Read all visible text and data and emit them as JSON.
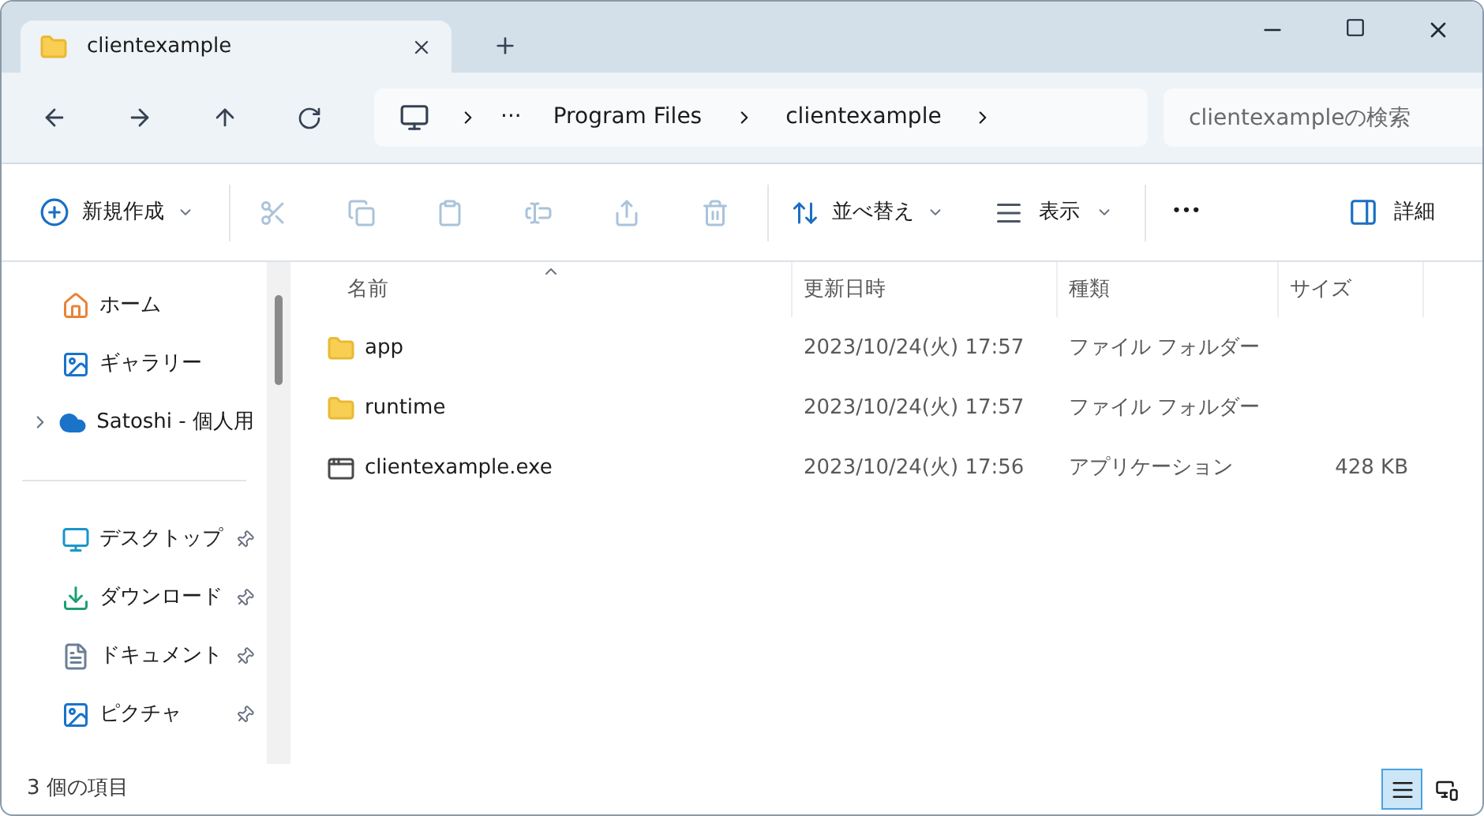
{
  "tab": {
    "title": "clientexample"
  },
  "address": {
    "crumbs": [
      "Program Files",
      "clientexample"
    ],
    "overflow": "···"
  },
  "search": {
    "placeholder": "clientexampleの検索"
  },
  "toolbar": {
    "new_label": "新規作成",
    "actions": [
      {
        "kind": "cut",
        "disabled": true
      },
      {
        "kind": "copy",
        "disabled": true
      },
      {
        "kind": "paste",
        "disabled": true
      },
      {
        "kind": "rename",
        "disabled": true
      },
      {
        "kind": "share",
        "disabled": true
      },
      {
        "kind": "delete",
        "disabled": true
      }
    ],
    "sort_label": "並べ替え",
    "view_label": "表示",
    "more": "•••",
    "details_label": "詳細"
  },
  "sidebar": {
    "items": [
      {
        "kind": "home",
        "label": "ホーム",
        "expandable": false
      },
      {
        "kind": "gallery",
        "label": "ギャラリー",
        "expandable": false
      },
      {
        "kind": "cloud",
        "label": "Satoshi - 個人用",
        "expandable": true
      }
    ],
    "pinned": [
      {
        "kind": "desktop",
        "label": "デスクトップ",
        "pinned": true
      },
      {
        "kind": "download",
        "label": "ダウンロード",
        "pinned": true
      },
      {
        "kind": "document",
        "label": "ドキュメント",
        "pinned": true
      },
      {
        "kind": "picture",
        "label": "ピクチャ",
        "pinned": true
      }
    ]
  },
  "table": {
    "columns": [
      {
        "label": "名前",
        "sorted": true
      },
      {
        "label": "更新日時",
        "sorted": false
      },
      {
        "label": "種類",
        "sorted": false
      },
      {
        "label": "サイズ",
        "sorted": false
      }
    ],
    "rows": [
      {
        "kind": "folder",
        "name": "app",
        "modified": "2023/10/24(火) 17:57",
        "type": "ファイル フォルダー"
      },
      {
        "kind": "folder",
        "name": "runtime",
        "modified": "2023/10/24(火) 17:57",
        "type": "ファイル フォルダー"
      },
      {
        "kind": "exe",
        "name": "clientexample.exe",
        "modified": "2023/10/24(火) 17:56",
        "type": "アプリケーション",
        "size": "428 KB"
      }
    ]
  },
  "status_bar": {
    "count": "3 個の項目",
    "views": [
      {
        "kind": "details",
        "selected": true
      },
      {
        "kind": "tiles",
        "selected": false
      }
    ]
  }
}
